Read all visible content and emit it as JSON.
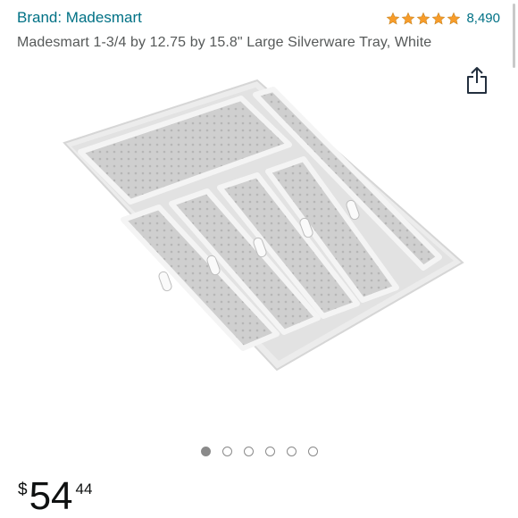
{
  "brand_link": "Brand: Madesmart",
  "rating": {
    "stars": 5,
    "count": "8,490",
    "star_color": "#F79C2A"
  },
  "product_title": "Madesmart 1-3/4 by 12.75 by 15.8\" Large Silverware Tray, White",
  "share_icon": "share-icon",
  "image_carousel": {
    "total": 6,
    "active_index": 0
  },
  "price": {
    "symbol": "$",
    "whole": "54",
    "fraction": "44"
  },
  "colors": {
    "link": "#007185",
    "text": "#0F1111",
    "secondary_text": "#565959"
  }
}
